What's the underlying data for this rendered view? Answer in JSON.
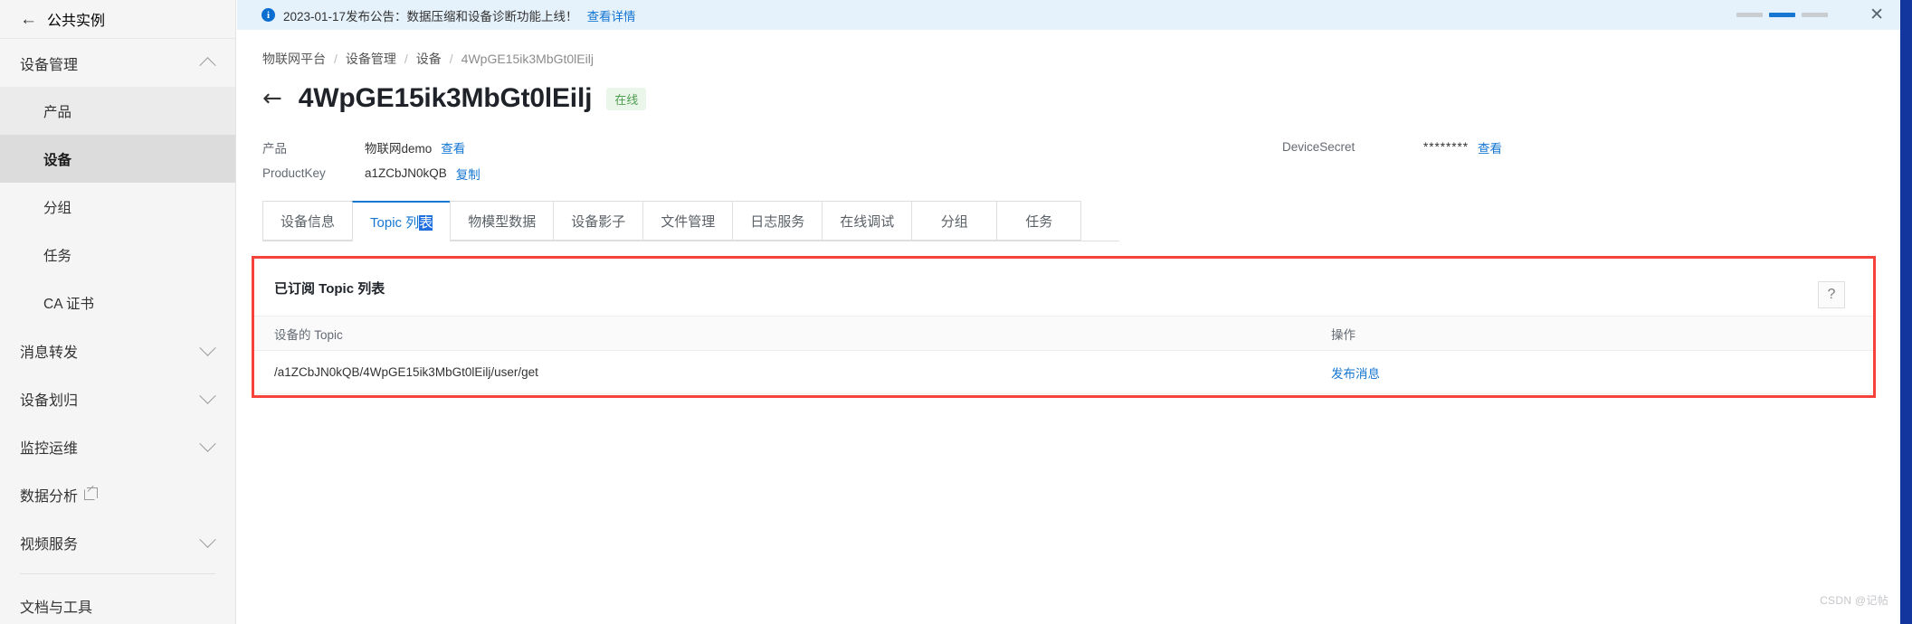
{
  "sidebar": {
    "instance": {
      "back_icon": "arrow-left-icon",
      "name": "公共实例"
    },
    "group": {
      "label": "设备管理",
      "chevron": "chevron-up-icon"
    },
    "sub_items": [
      {
        "label": "产品",
        "state": "hover"
      },
      {
        "label": "设备",
        "state": "active"
      },
      {
        "label": "分组",
        "state": "normal"
      },
      {
        "label": "任务",
        "state": "normal"
      },
      {
        "label": "CA 证书",
        "state": "normal"
      }
    ],
    "items": [
      {
        "label": "消息转发",
        "chevron": "chevron-down-icon",
        "external": false
      },
      {
        "label": "设备划归",
        "chevron": "chevron-down-icon",
        "external": false
      },
      {
        "label": "监控运维",
        "chevron": "chevron-down-icon",
        "external": false
      },
      {
        "label": "数据分析",
        "chevron": "",
        "external": true
      },
      {
        "label": "视频服务",
        "chevron": "chevron-down-icon",
        "external": false
      }
    ],
    "footer_item": {
      "label": "文档与工具"
    }
  },
  "notice": {
    "icon": "info-circle-icon",
    "text": "2023-01-17发布公告：数据压缩和设备诊断功能上线！",
    "link": "查看详情",
    "carousel": {
      "count": 3,
      "active_index": 1
    },
    "close_icon": "close-icon",
    "accent": "#1677d2",
    "background": "#e5f1fb"
  },
  "breadcrumb": {
    "items": [
      "物联网平台",
      "设备管理",
      "设备",
      "4WpGE15ik3MbGt0lEilj"
    ],
    "separator": "/"
  },
  "page": {
    "back_icon": "arrow-left-icon",
    "title": "4WpGE15ik3MbGt0lEilj",
    "status": "在线",
    "status_color": "#4e9e51"
  },
  "info": {
    "product": {
      "label": "产品",
      "value": "物联网demo",
      "action": "查看"
    },
    "product_key": {
      "label": "ProductKey",
      "value": "a1ZCbJN0kQB",
      "action": "复制"
    },
    "device_secret": {
      "label": "DeviceSecret",
      "value": "********",
      "action": "查看"
    }
  },
  "tabs": [
    {
      "label": "设备信息",
      "active": false
    },
    {
      "label": "Topic 列表",
      "active": true,
      "selection": "表"
    },
    {
      "label": "物模型数据",
      "active": false
    },
    {
      "label": "设备影子",
      "active": false
    },
    {
      "label": "文件管理",
      "active": false
    },
    {
      "label": "日志服务",
      "active": false
    },
    {
      "label": "在线调试",
      "active": false
    },
    {
      "label": "分组",
      "active": false
    },
    {
      "label": "任务",
      "active": false
    }
  ],
  "panel": {
    "title": "已订阅 Topic 列表",
    "highlight_color": "#f5423a",
    "columns": [
      "设备的 Topic",
      "操作"
    ],
    "rows": [
      {
        "topic": "/a1ZCbJN0kQB/4WpGE15ik3MbGt0lEilj/user/get",
        "action": "发布消息"
      }
    ]
  },
  "help": {
    "icon": "question-mark-icon",
    "label": "?"
  },
  "watermark": "CSDN @记帖"
}
